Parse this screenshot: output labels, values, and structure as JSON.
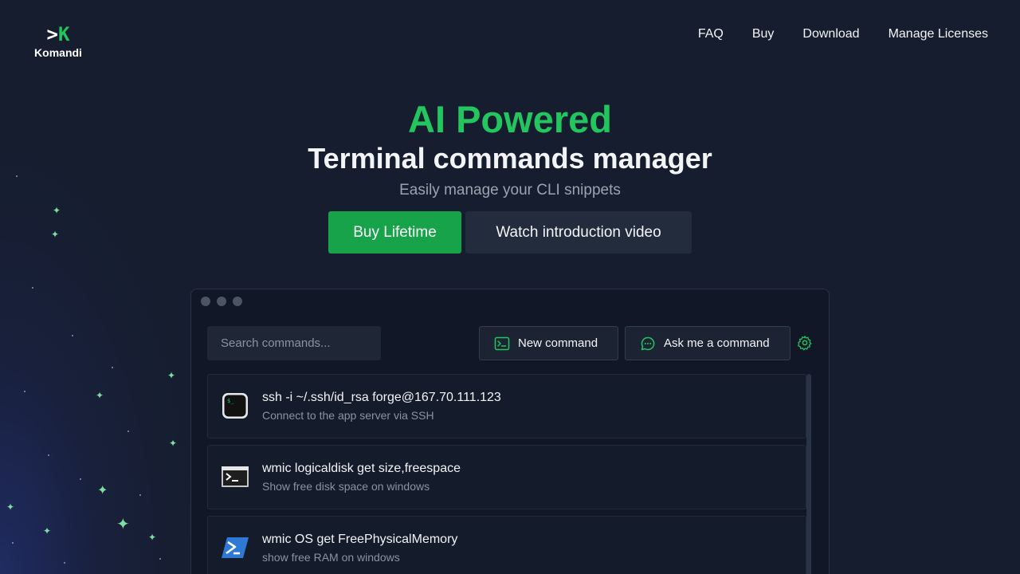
{
  "brand": {
    "mark_prefix": ">",
    "mark_letter": "K",
    "name": "Komandi"
  },
  "nav": [
    {
      "label": "FAQ"
    },
    {
      "label": "Buy"
    },
    {
      "label": "Download"
    },
    {
      "label": "Manage Licenses"
    }
  ],
  "hero": {
    "accent": "AI Powered",
    "title": "Terminal commands manager",
    "subtitle": "Easily manage your CLI snippets",
    "primary_cta": "Buy Lifetime",
    "secondary_cta": "Watch introduction video"
  },
  "app": {
    "search_placeholder": "Search commands...",
    "new_command_label": "New command",
    "ask_label": "Ask me a command",
    "commands": [
      {
        "command": "ssh -i ~/.ssh/id_rsa forge@167.70.111.123",
        "description": "Connect to the app server via SSH",
        "icon": "terminal-icon"
      },
      {
        "command": "wmic logicaldisk get size,freespace",
        "description": "Show free disk space on windows",
        "icon": "cmd-icon"
      },
      {
        "command": "wmic OS get FreePhysicalMemory",
        "description": "show free RAM on windows",
        "icon": "powershell-icon"
      }
    ]
  },
  "colors": {
    "accent": "#22c55e",
    "button_primary": "#16a34a",
    "background": "#161d2e"
  }
}
